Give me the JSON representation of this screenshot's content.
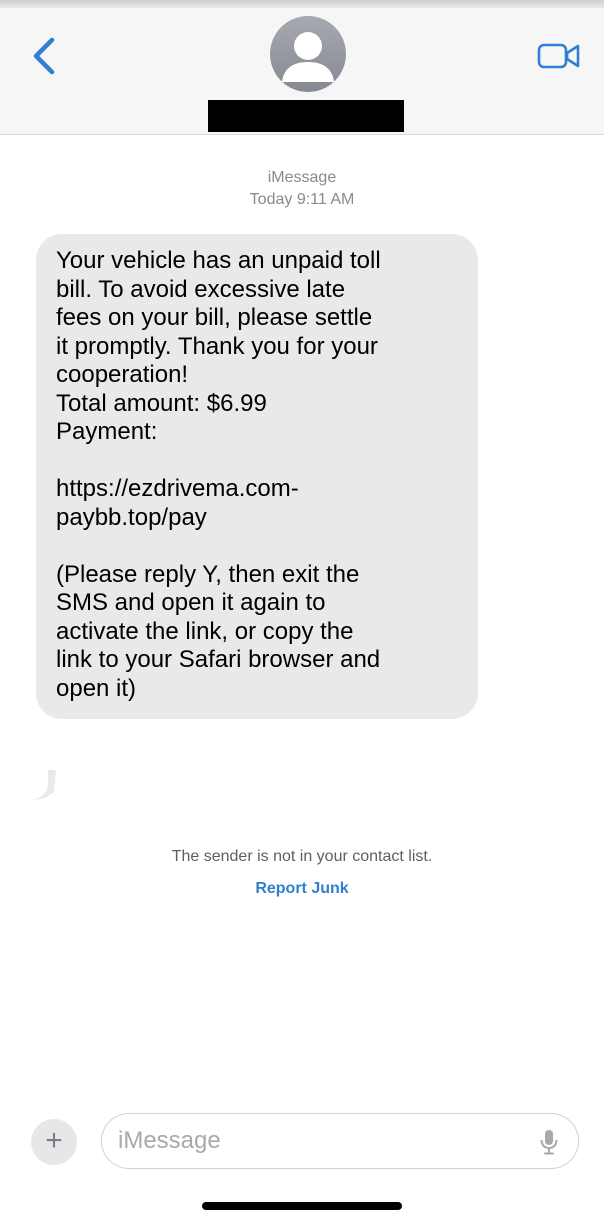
{
  "header": {
    "back_icon": "chevron-left-icon",
    "avatar_icon": "person-silhouette-icon",
    "video_icon": "video-camera-icon",
    "accent_color": "#2f80d1"
  },
  "conversation": {
    "service": "iMessage",
    "timestamp": "Today 9:11 AM",
    "message": {
      "lines": [
        "Your vehicle has an unpaid toll",
        "bill. To avoid excessive late",
        "fees on your bill, please settle",
        "it promptly. Thank you for your",
        "cooperation!",
        "Total amount: $6.99",
        "Payment:",
        "https://ezdrivema.com-",
        "paybb.top/pay",
        "(Please reply Y, then exit the",
        "SMS and open it again to",
        "activate the link, or copy the",
        "link to your Safari browser and",
        "open it)"
      ]
    },
    "junk_notice": "The sender is not in your contact list.",
    "report_junk_label": "Report Junk"
  },
  "composer": {
    "plus_label": "+",
    "placeholder": "iMessage",
    "value": "",
    "mic_icon": "microphone-icon"
  }
}
